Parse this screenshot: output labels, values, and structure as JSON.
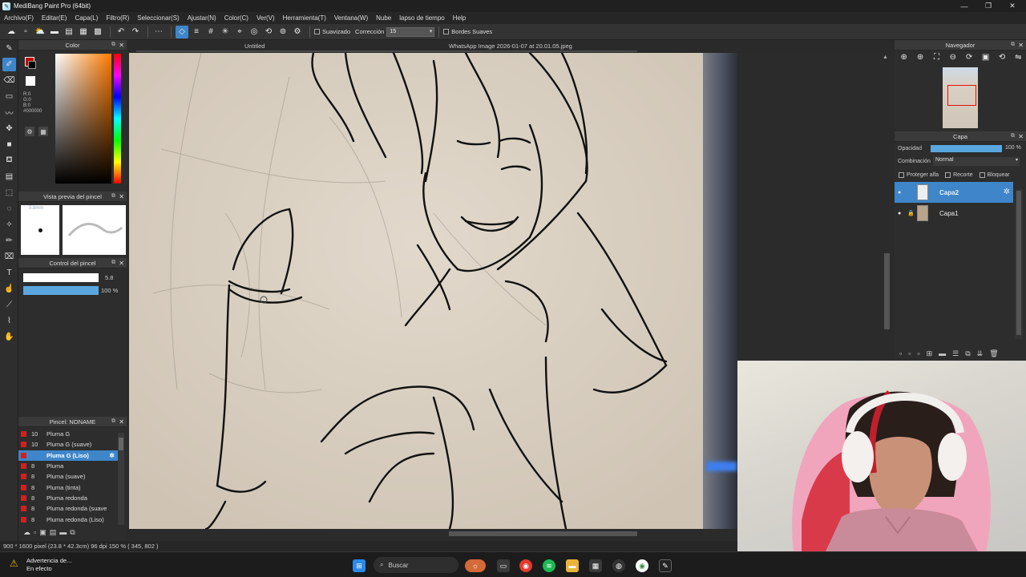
{
  "window": {
    "title": "MediBang Paint Pro (64bit)",
    "minimize": "—",
    "maximize": "❐",
    "close": "✕"
  },
  "menu": [
    "Archivo(F)",
    "Editar(E)",
    "Capa(L)",
    "Filtro(R)",
    "Seleccionar(S)",
    "Ajustar(N)",
    "Color(C)",
    "Ver(V)",
    "Herramienta(T)",
    "Ventana(W)",
    "Nube",
    "lapso de tiempo",
    "Help"
  ],
  "toolbar": {
    "smoothing_label": "Suavizado",
    "correction_label": "Corrección",
    "correction_value": "15",
    "soft_edges_label": "Bordes Suaves"
  },
  "doc": {
    "tab1": "Untitled",
    "tab2": "WhatsApp Image 2026-01-07 at 20.01.05.jpeg"
  },
  "color_panel": {
    "title": "Color",
    "r": "R:0",
    "g": "G:0",
    "b": "B:0",
    "hex": "#000000",
    "primary": "#c00000",
    "secondary": "#ffffff"
  },
  "brush_preview": {
    "title": "Vista previa del pincel",
    "size_label": "5.8mm"
  },
  "brush_control": {
    "title": "Control del pincel",
    "size": "5.8",
    "opacity": "100 %",
    "opacity_fraction": 1.0
  },
  "brush_list": {
    "title": "Pincel: NONAME",
    "items": [
      {
        "size": "10",
        "name": "Pluma G",
        "selected": false
      },
      {
        "size": "10",
        "name": "Pluma G (suave)",
        "selected": false
      },
      {
        "size": "",
        "name": "Pluma G (Liso)",
        "selected": true
      },
      {
        "size": "8",
        "name": "Pluma",
        "selected": false
      },
      {
        "size": "8",
        "name": "Pluma (suave)",
        "selected": false
      },
      {
        "size": "8",
        "name": "Pluma (tinta)",
        "selected": false
      },
      {
        "size": "8",
        "name": "Pluma redonda",
        "selected": false
      },
      {
        "size": "8",
        "name": "Pluma redonda (suave",
        "selected": false
      },
      {
        "size": "8",
        "name": "Pluma redonda (Liso)",
        "selected": false
      }
    ]
  },
  "status": {
    "text": "900 * 1600 pixel   (23.8 * 42.3cm)   96 dpi   150 %   ( 345, 802 )"
  },
  "navigator": {
    "title": "Navegador"
  },
  "layer_panel": {
    "title": "Capa",
    "opacity_label": "Opacidad",
    "opacity_value": "100 %",
    "opacity_fraction": 1.0,
    "blend_label": "Combinación",
    "blend_value": "Normal",
    "protect_alpha": "Proteger alfa",
    "clipping": "Recorte",
    "lock": "Bloquear",
    "layers": [
      {
        "name": "Capa2",
        "selected": true
      },
      {
        "name": "Capa1",
        "selected": false
      }
    ]
  },
  "taskbar": {
    "warning_title": "Advertencia de...",
    "warning_sub": "En efecto",
    "search_placeholder": "Buscar"
  }
}
